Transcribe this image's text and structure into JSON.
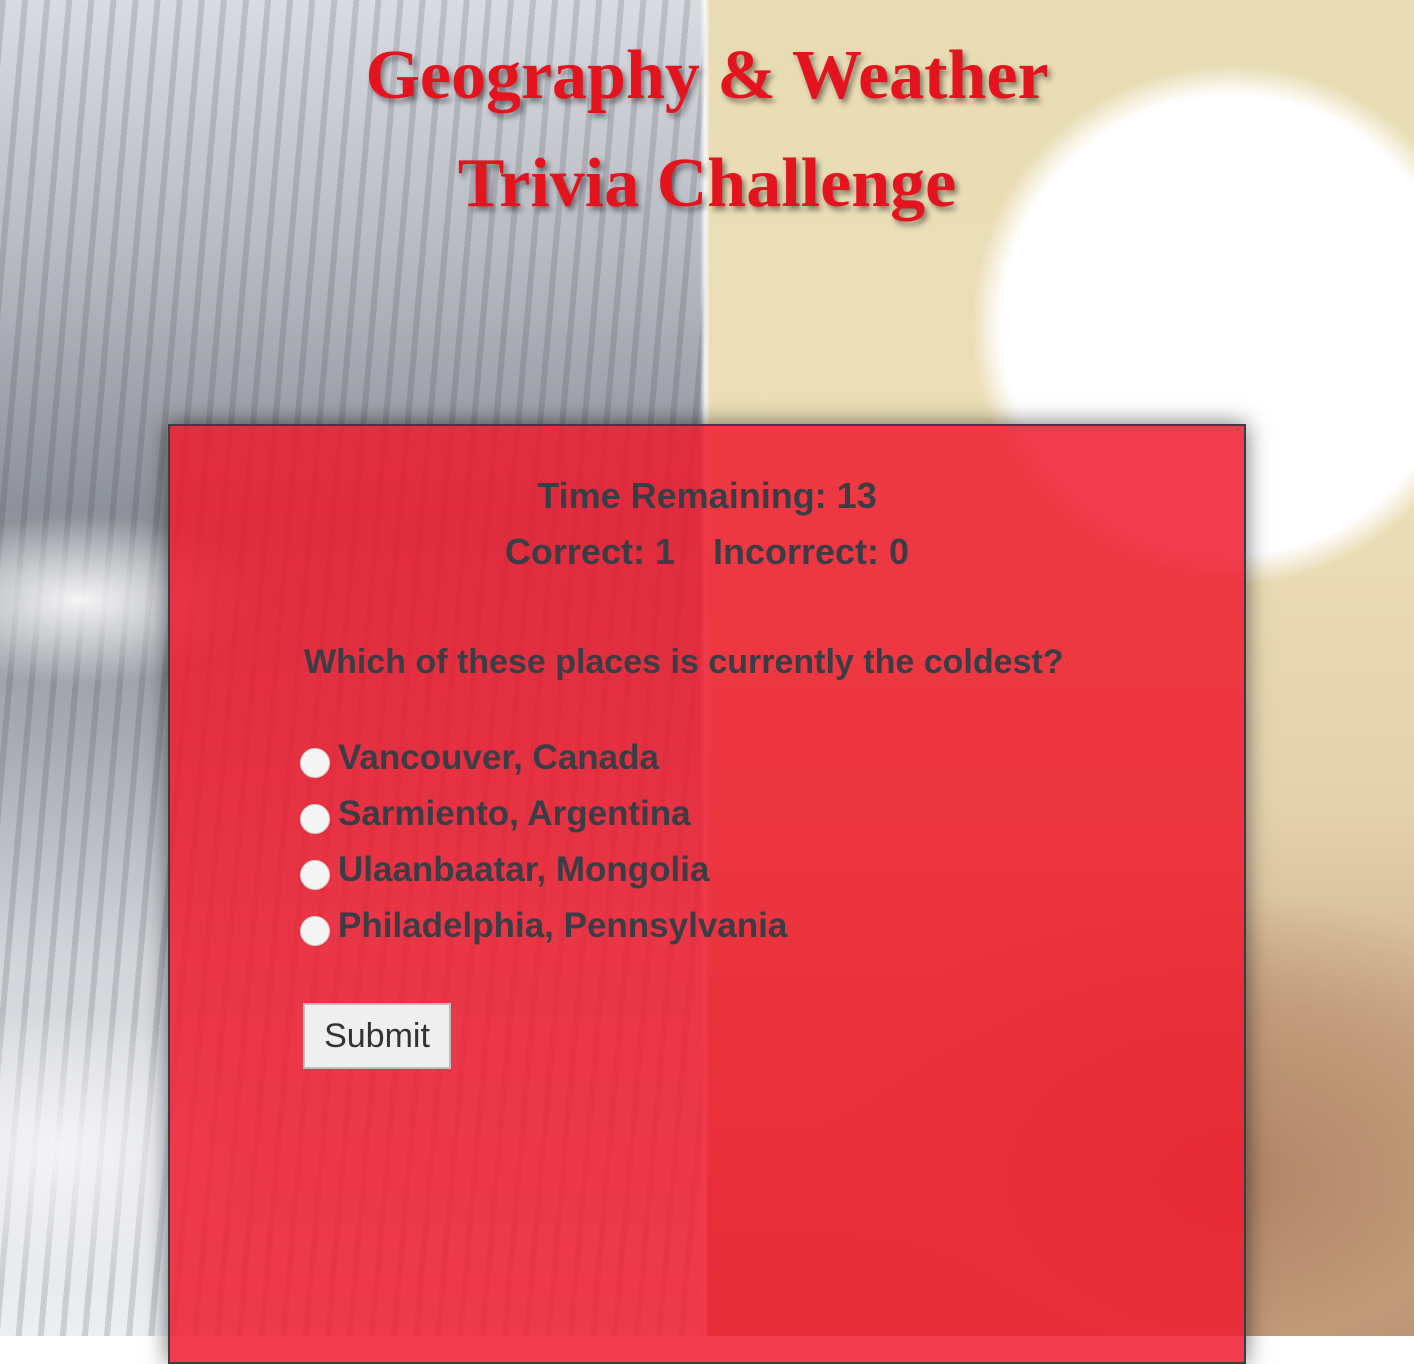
{
  "title": {
    "line1": "Geography & Weather",
    "line2": "Trivia Challenge"
  },
  "status": {
    "time_remaining": "Time Remaining: 13",
    "correct": "Correct: 1",
    "incorrect": "Incorrect: 0"
  },
  "question": {
    "text": "Which of these places is currently the coldest?",
    "options": [
      {
        "label": "Vancouver, Canada",
        "selected": false
      },
      {
        "label": "Sarmiento, Argentina",
        "selected": false
      },
      {
        "label": "Ulaanbaatar, Mongolia",
        "selected": false
      },
      {
        "label": "Philadelphia, Pennsylvania",
        "selected": false
      }
    ]
  },
  "submit_label": "Submit",
  "colors": {
    "title": "#e4141f",
    "panel": "#ee1c2e",
    "panel_text": "#3a3d45"
  }
}
